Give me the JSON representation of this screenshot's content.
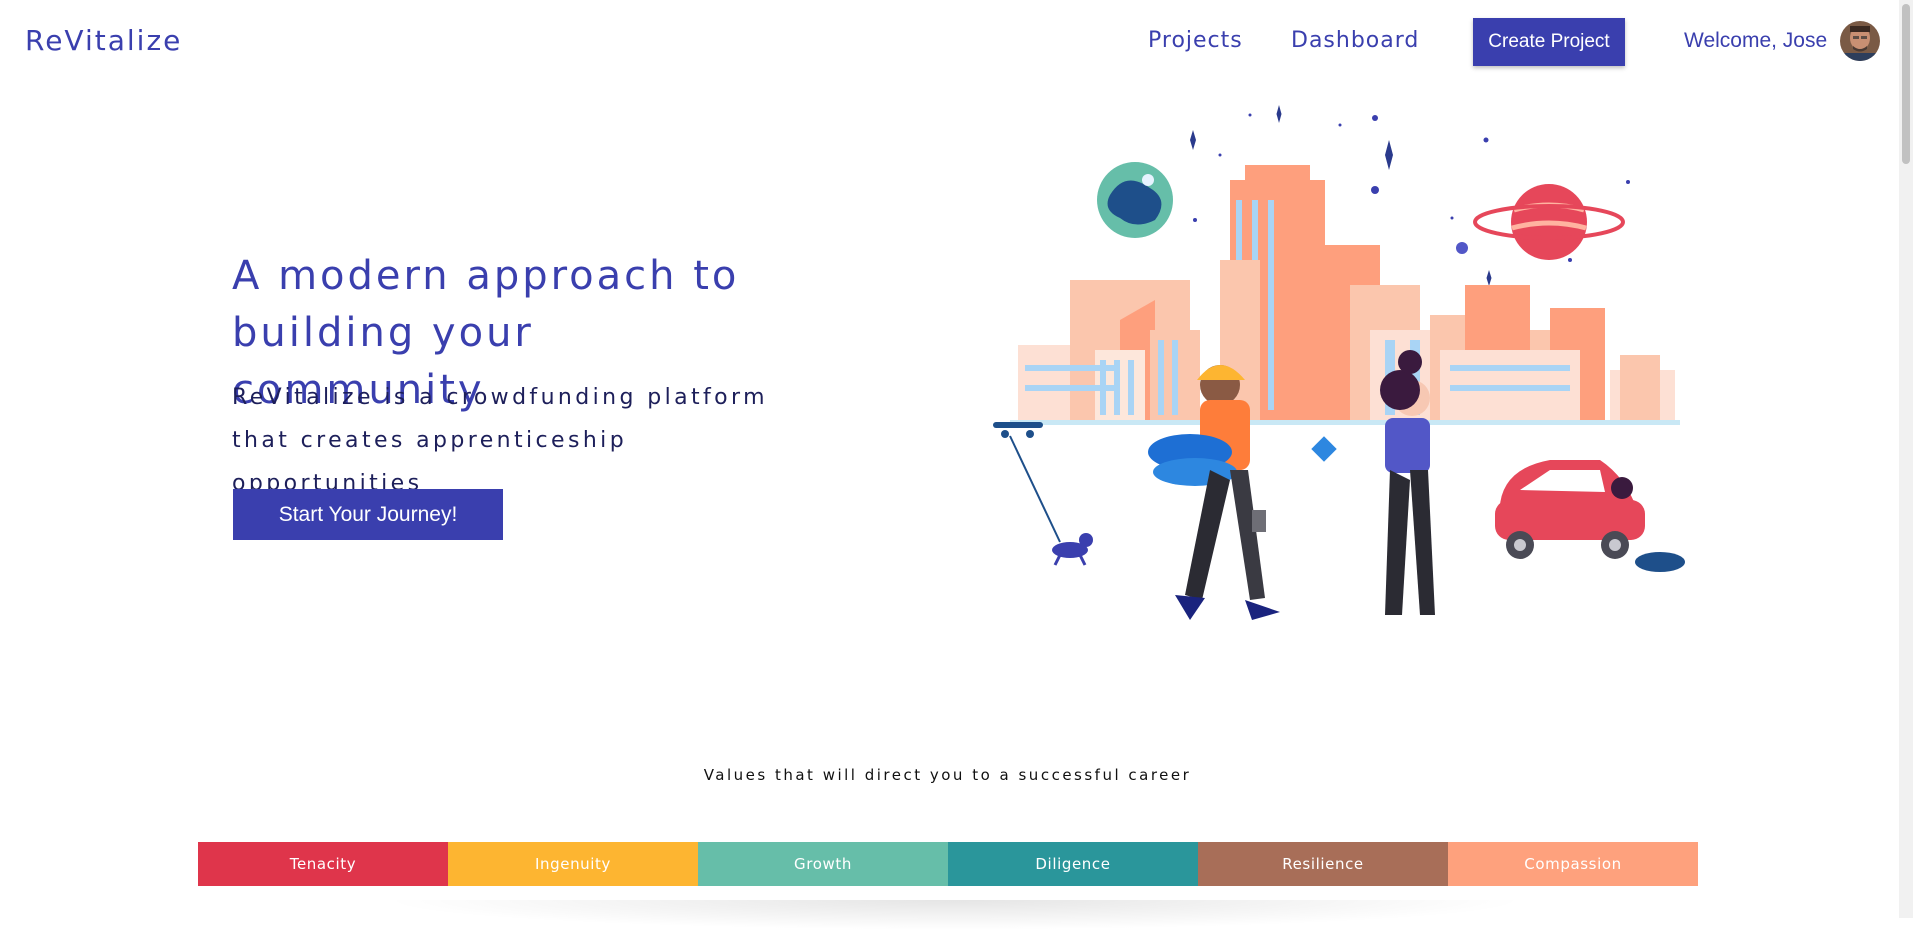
{
  "nav": {
    "logo": "ReVitalize",
    "projects": "Projects",
    "dashboard": "Dashboard",
    "create_project": "Create Project",
    "welcome": "Welcome, Jose"
  },
  "hero": {
    "title_line1": "A modern approach to",
    "title_line2": "building your community",
    "sub_line1": "ReVitalize is a crowdfunding platform",
    "sub_line2": "that creates apprenticeship opportunities",
    "cta": "Start Your Journey!"
  },
  "values": {
    "caption": "Values that will direct you to a successful career",
    "items": [
      {
        "label": "Tenacity",
        "color": "#df354b"
      },
      {
        "label": "Ingenuity",
        "color": "#fdb531"
      },
      {
        "label": "Growth",
        "color": "#66bea9"
      },
      {
        "label": "Diligence",
        "color": "#2a969b"
      },
      {
        "label": "Resilience",
        "color": "#a86e58"
      },
      {
        "label": "Compassion",
        "color": "#fea17d"
      }
    ]
  },
  "colors": {
    "brand": "#3a3fae",
    "text_dark": "#1d1f5a"
  },
  "icons": {
    "avatar": "user-avatar",
    "illustration": "city-illustration"
  }
}
